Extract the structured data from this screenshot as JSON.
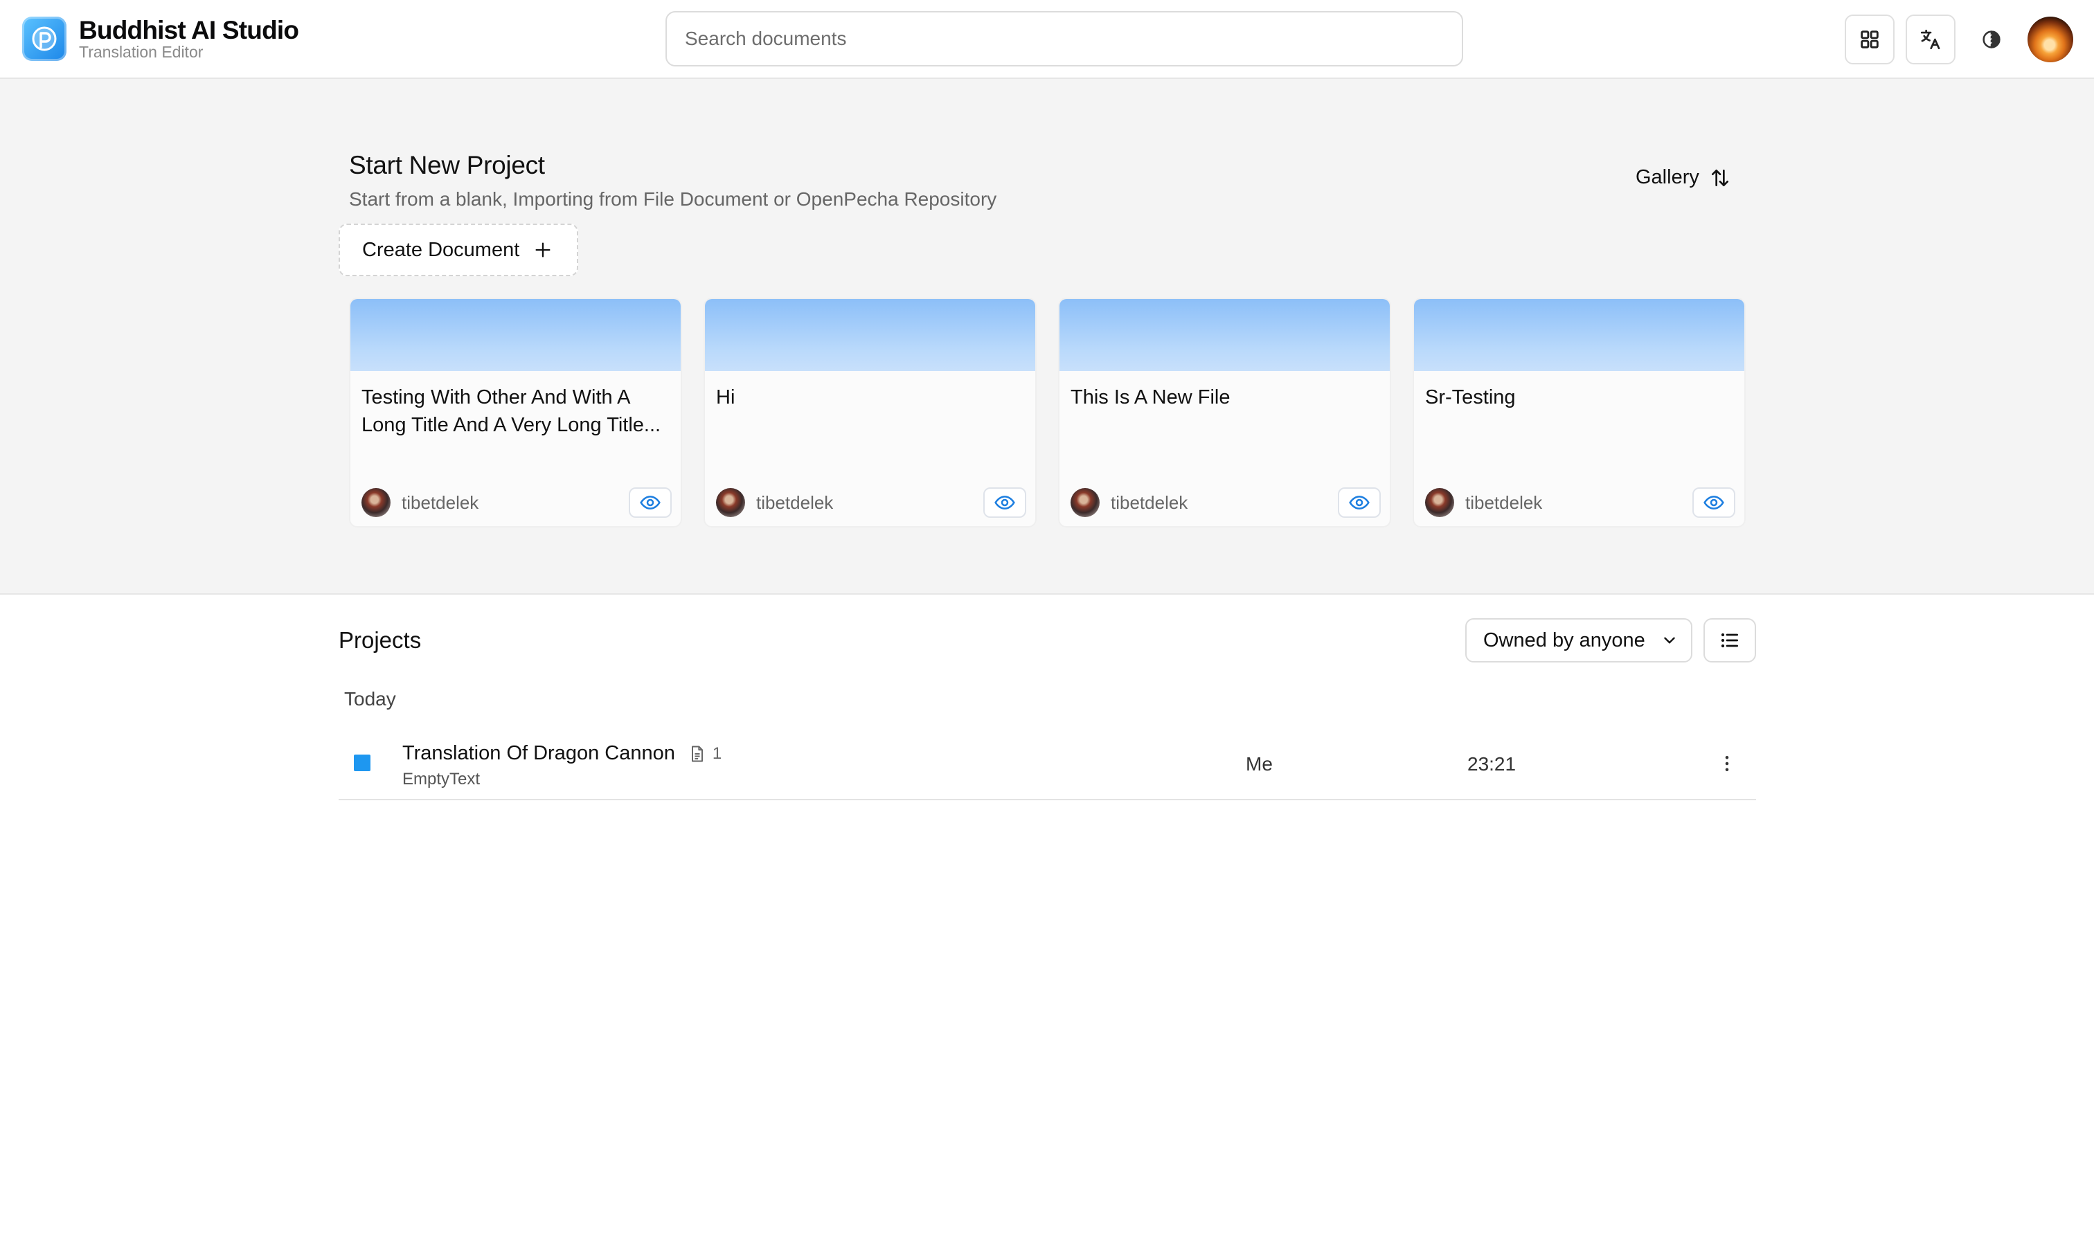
{
  "app": {
    "title": "Buddhist AI Studio",
    "subtitle": "Translation Editor",
    "logo_icon": "app-logo-icon",
    "accent_color": "#1e97f0"
  },
  "header": {
    "search_placeholder": "Search documents",
    "actions": [
      {
        "icon": "grid-icon"
      },
      {
        "icon": "translate-icon"
      },
      {
        "icon": "theme-toggle-icon"
      },
      {
        "icon": "user-avatar"
      }
    ]
  },
  "new_project": {
    "title": "Start New Project",
    "subtitle": "Start from a blank, Importing from File Document or OpenPecha Repository",
    "view_label": "Gallery",
    "create_label": "Create Document",
    "cards": [
      {
        "title": "Testing With Other And With A Long Title And A Very Long Title...",
        "user": "tibetdelek"
      },
      {
        "title": "Hi",
        "user": "tibetdelek"
      },
      {
        "title": "This Is A New File",
        "user": "tibetdelek"
      },
      {
        "title": "Sr-Testing",
        "user": "tibetdelek"
      }
    ]
  },
  "projects": {
    "title": "Projects",
    "filter_label": "Owned by anyone",
    "groups": [
      {
        "label": "Today",
        "rows": [
          {
            "name": "Translation Of Dragon Cannon",
            "doc_count": "1",
            "type": "EmptyText",
            "owner": "Me",
            "time": "23:21"
          }
        ]
      }
    ]
  }
}
